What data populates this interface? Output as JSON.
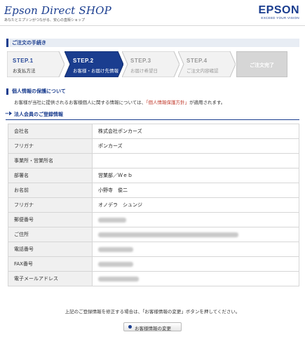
{
  "header": {
    "shop_logo": "Epson Direct SHOP",
    "tagline": "あなたとエプソンがつながる、安心の直販ショップ",
    "brand": "EPSON",
    "slogan": "EXCEED YOUR VISION"
  },
  "section": {
    "title": "ご注文の手続き"
  },
  "steps": [
    {
      "num": "STEP.1",
      "label": "お支払方法",
      "state": "done"
    },
    {
      "num": "STEP.2",
      "label": "お客様・お届け先情報",
      "state": "active"
    },
    {
      "num": "STEP.3",
      "label": "お届け希望日",
      "state": "future"
    },
    {
      "num": "STEP.4",
      "label": "ご注文内容確認",
      "state": "future"
    },
    {
      "num": "",
      "label": "ご注文完了",
      "state": "final"
    }
  ],
  "privacy": {
    "title": "個人情報の保護について",
    "text_before": "お客様が当社に提供されるお客様個人に関する情報については、",
    "link": "「個人情報保護方針」",
    "text_after": "が適用されます。"
  },
  "corporate": {
    "title": "法人会員のご登録情報",
    "rows": [
      {
        "label": "会社名",
        "value": "株式会社ポンカーズ"
      },
      {
        "label": "フリガナ",
        "value": "ポンカーズ"
      },
      {
        "label": "事業所・営業所名",
        "value": ""
      },
      {
        "label": "部署名",
        "value": "営業部／Ｗｅｂ"
      },
      {
        "label": "お名前",
        "value": "小野寺　俊二"
      },
      {
        "label": "フリガナ",
        "value": "オノデラ　シュンジ"
      },
      {
        "label": "郵便番号",
        "value": ""
      },
      {
        "label": "ご住所",
        "value": ""
      },
      {
        "label": "電話番号",
        "value": ""
      },
      {
        "label": "FAX番号",
        "value": ""
      },
      {
        "label": "電子メールアドレス",
        "value": ""
      }
    ]
  },
  "footnote": "上記のご登録情報を修正する場合は、「お客様情報の変更」ボタンを押してください。",
  "change_button": "お客様情報の変更",
  "colors": {
    "brand_blue": "#1a3d8f",
    "link_red": "#c0392b"
  }
}
